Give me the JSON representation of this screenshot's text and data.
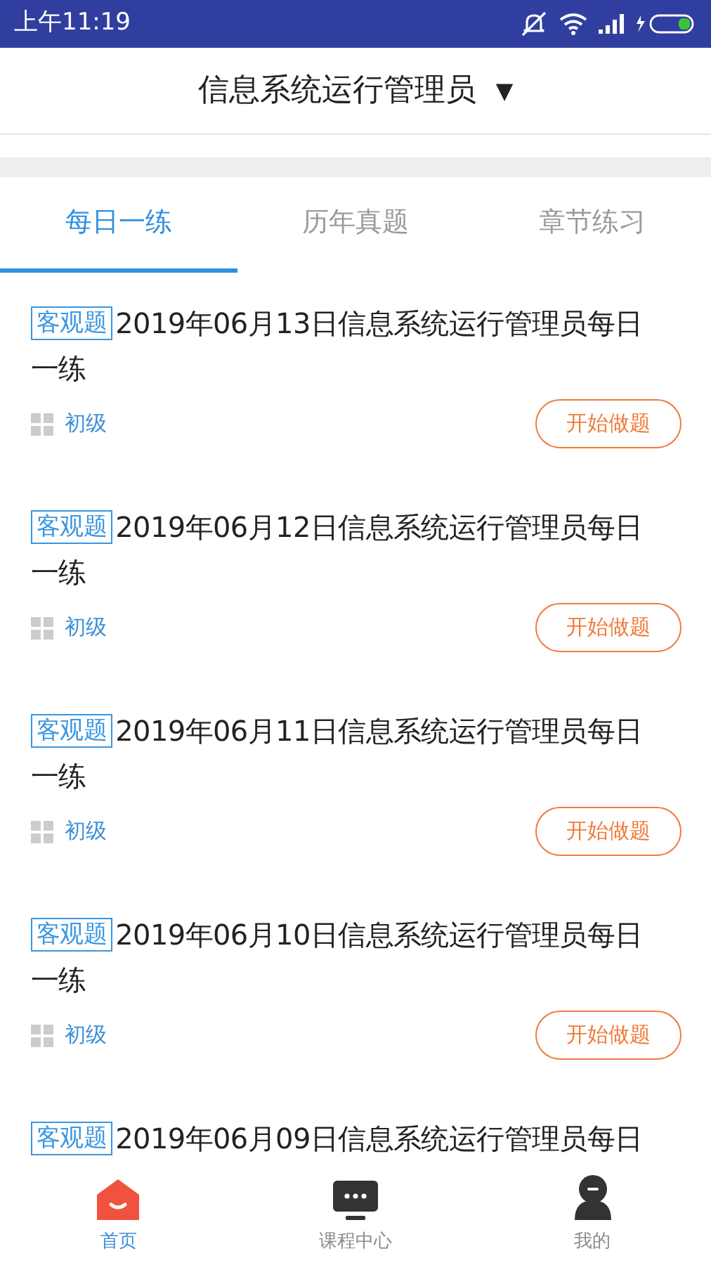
{
  "status_bar": {
    "time": "上午11:19"
  },
  "header": {
    "title": "信息系统运行管理员",
    "dropdown_glyph": "▼"
  },
  "tabs": [
    {
      "label": "每日一练",
      "selected": true
    },
    {
      "label": "历年真题",
      "selected": false
    },
    {
      "label": "章节练习",
      "selected": false
    }
  ],
  "exercises": [
    {
      "tag": "客观题",
      "title": "2019年06月13日信息系统运行管理员每日一练",
      "level": "初级",
      "button": "开始做题"
    },
    {
      "tag": "客观题",
      "title": "2019年06月12日信息系统运行管理员每日一练",
      "level": "初级",
      "button": "开始做题"
    },
    {
      "tag": "客观题",
      "title": "2019年06月11日信息系统运行管理员每日一练",
      "level": "初级",
      "button": "开始做题"
    },
    {
      "tag": "客观题",
      "title": "2019年06月10日信息系统运行管理员每日一练",
      "level": "初级",
      "button": "开始做题"
    },
    {
      "tag": "客观题",
      "title": "2019年06月09日信息系统运行管理员每日"
    }
  ],
  "bottom_nav": [
    {
      "kind": "home",
      "label": "首页",
      "selected": true
    },
    {
      "kind": "courses",
      "label": "课程中心",
      "selected": false
    },
    {
      "kind": "profile",
      "label": "我的",
      "selected": false
    }
  ]
}
